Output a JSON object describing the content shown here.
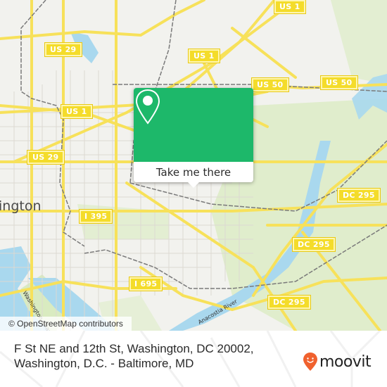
{
  "map": {
    "city_label": "ington",
    "river_labels": {
      "washington_channel": "Washington Channel",
      "anacostia_river": "Anacostia River"
    },
    "shields": [
      {
        "id": "us1-top",
        "label": "US 1"
      },
      {
        "id": "us29-top",
        "label": "US 29"
      },
      {
        "id": "us1-mid",
        "label": "US 1"
      },
      {
        "id": "us1-left",
        "label": "US 1"
      },
      {
        "id": "us50-left",
        "label": "US 50"
      },
      {
        "id": "us50-right",
        "label": "US 50"
      },
      {
        "id": "us29-mid",
        "label": "US 29"
      },
      {
        "id": "i395",
        "label": "I 395"
      },
      {
        "id": "dc295-upper",
        "label": "DC 295"
      },
      {
        "id": "dc295-mid",
        "label": "DC 295"
      },
      {
        "id": "i695",
        "label": "I 695"
      },
      {
        "id": "dc295-lower",
        "label": "DC 295"
      }
    ],
    "attribution": "© OpenStreetMap contributors",
    "colors": {
      "land": "#f2f2ee",
      "water": "#a9d8ee",
      "park": "#d9ebc0",
      "road": "#f7e15a",
      "rail": "#7a7a7a"
    }
  },
  "popup": {
    "icon": "location-pin-icon",
    "button_label": "Take me there",
    "color": "#1db86a"
  },
  "footer": {
    "address_line1": "F St NE and 12th St, Washington, DC 20002,",
    "address_line2": "Washington, D.C. - Baltimore, MD",
    "brand": "moovit",
    "brand_color": "#f0612e"
  }
}
